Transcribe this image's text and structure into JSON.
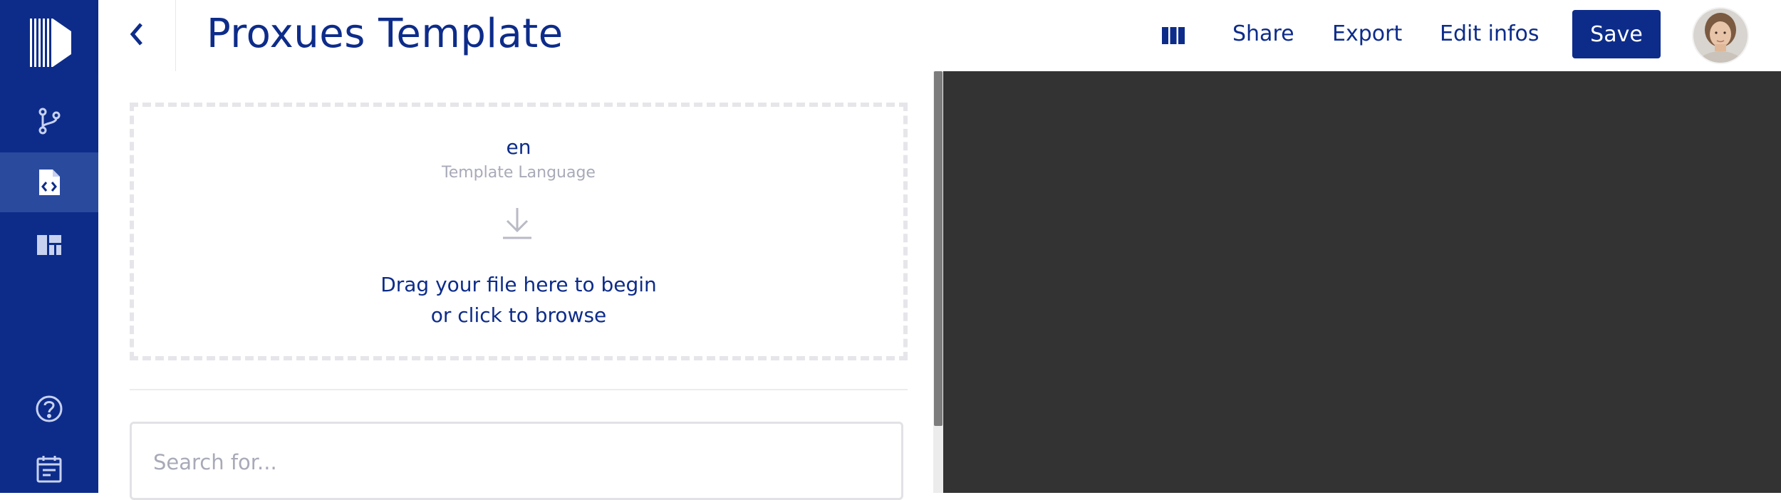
{
  "header": {
    "title": "Proxues Template",
    "actions": {
      "share": "Share",
      "export": "Export",
      "edit_infos": "Edit infos",
      "save": "Save"
    }
  },
  "sidebar": {
    "items": [
      {
        "icon": "logo-icon"
      },
      {
        "icon": "branch-icon"
      },
      {
        "icon": "code-file-icon",
        "active": true
      },
      {
        "icon": "dashboard-icon"
      },
      {
        "icon": "help-icon"
      },
      {
        "icon": "calendar-icon"
      }
    ]
  },
  "dropzone": {
    "language": "en",
    "language_label": "Template Language",
    "line1": "Drag your file here to begin",
    "line2": "or click to browse"
  },
  "search": {
    "placeholder": "Search for..."
  },
  "colors": {
    "brand": "#0d2c8a",
    "sidebar_active": "#2a4a9e",
    "preview_bg": "#333333"
  }
}
